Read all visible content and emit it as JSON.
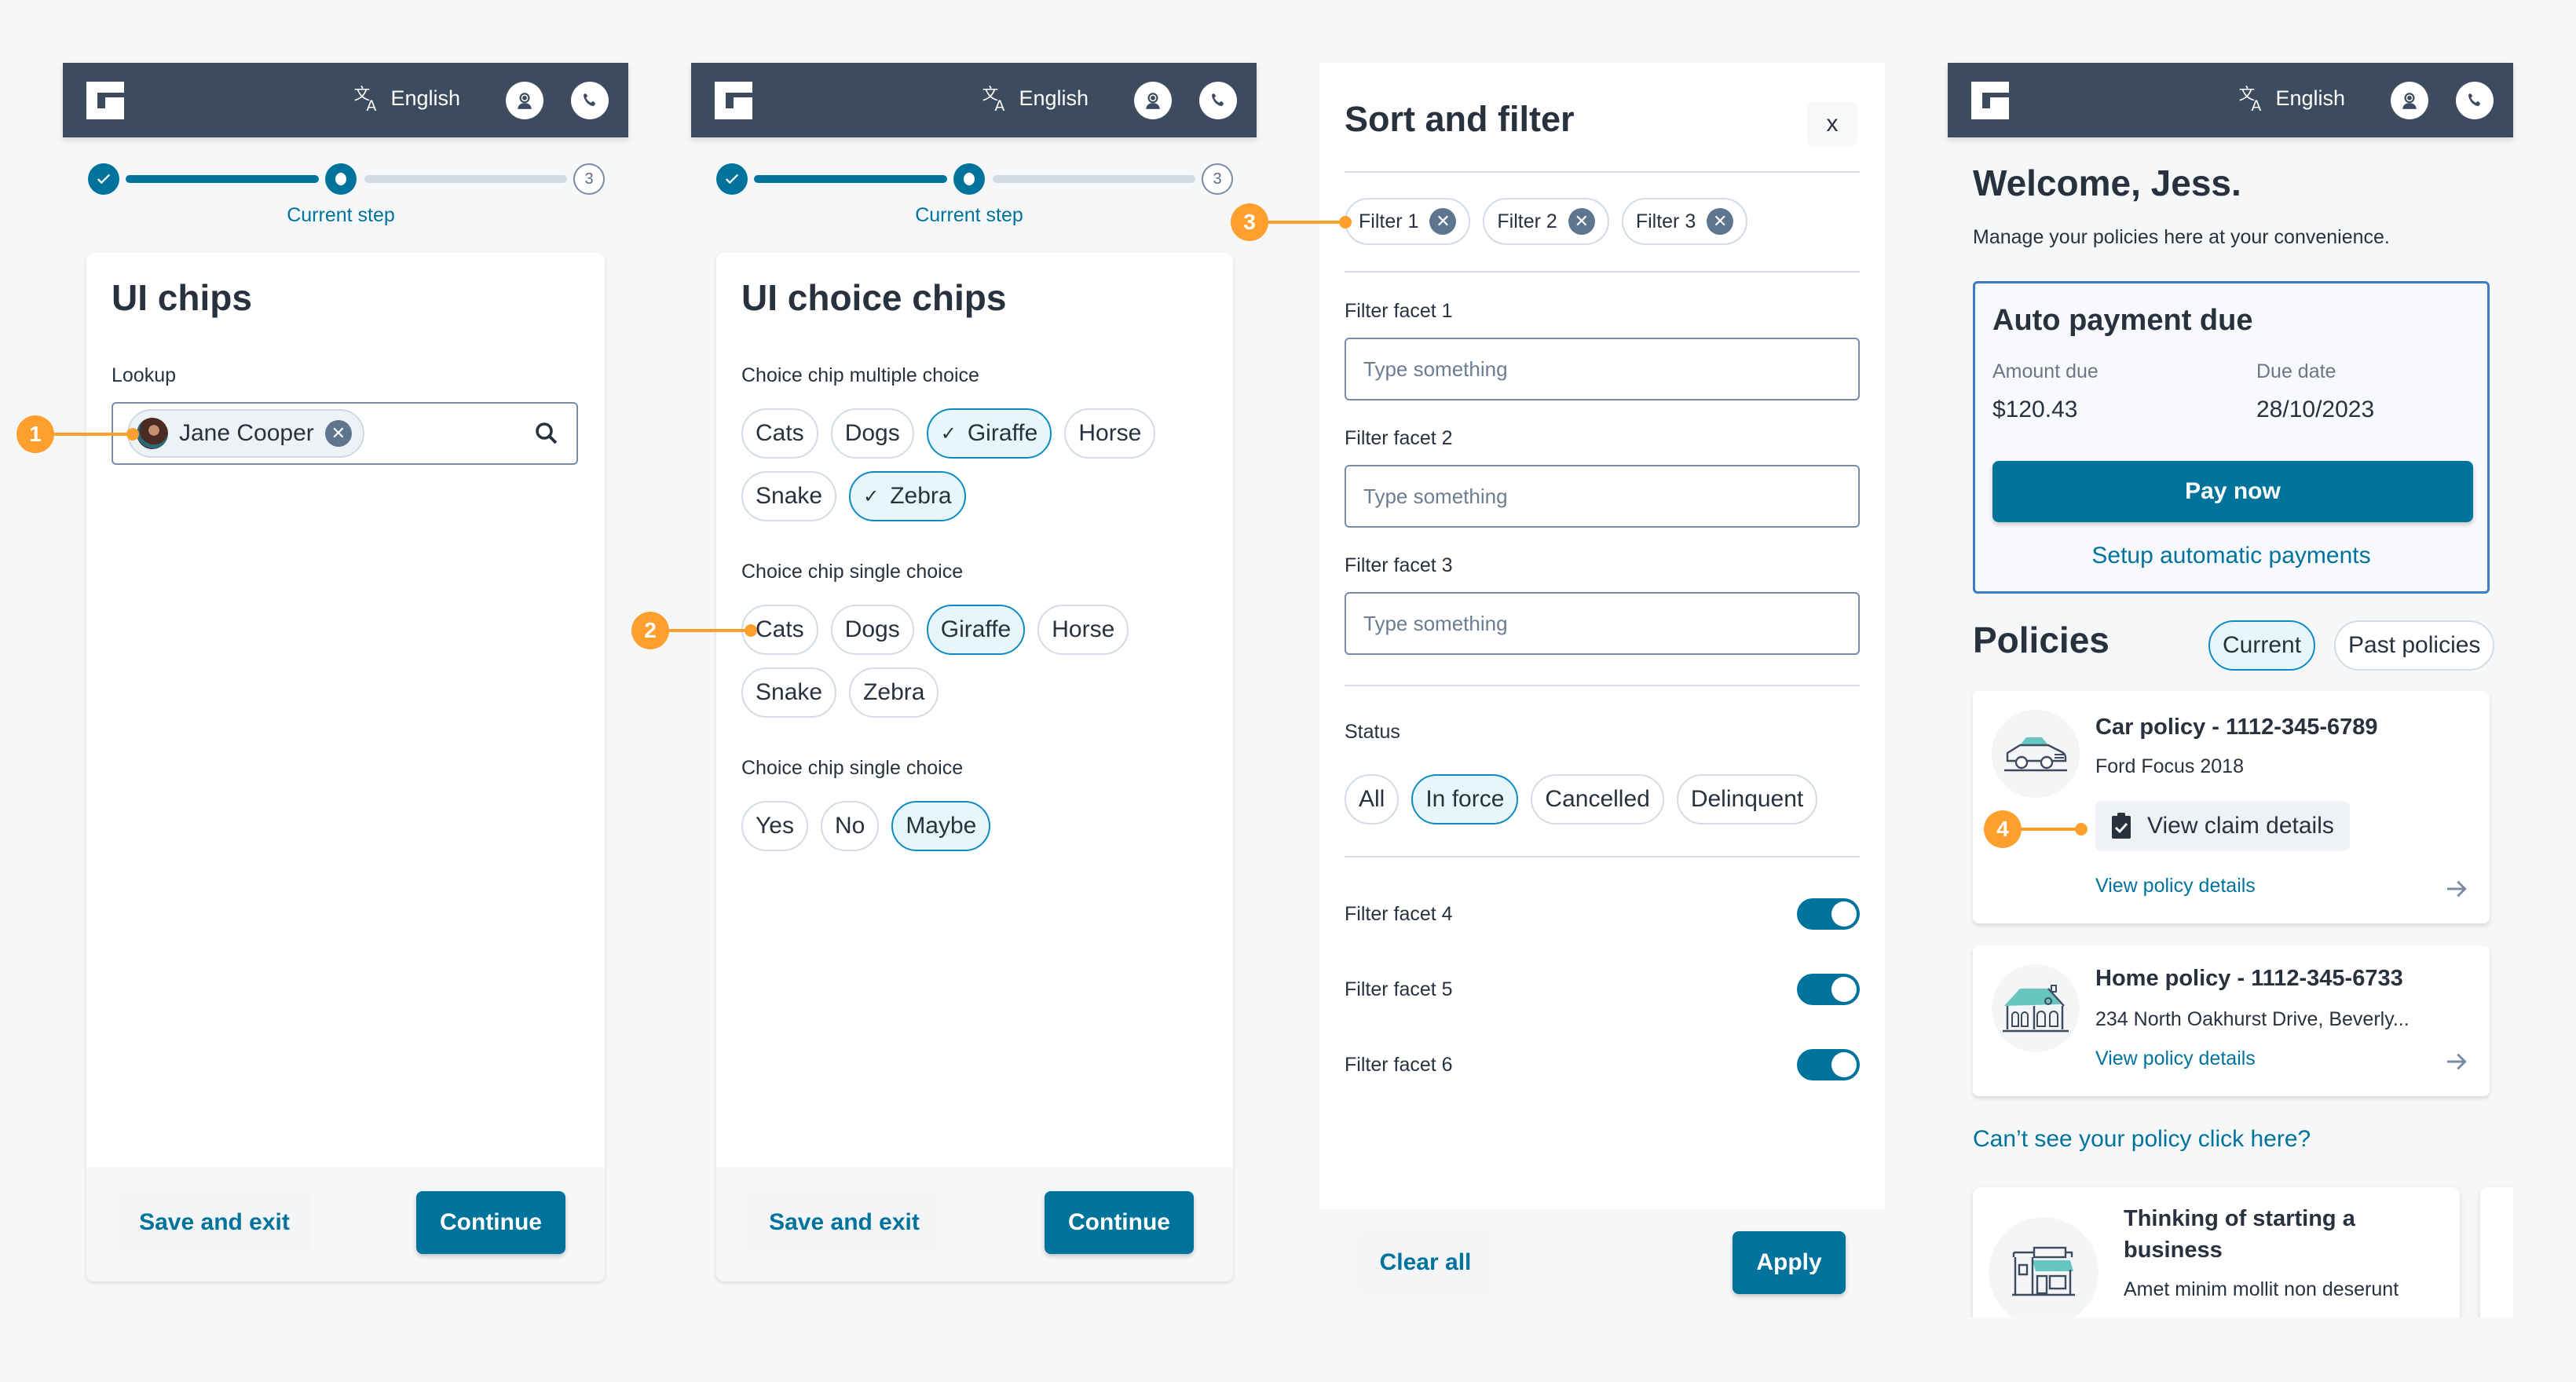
{
  "header": {
    "language": "English",
    "icons": {
      "logo": "brand-logo",
      "language": "translate-icon",
      "agent": "agent-icon",
      "phone": "phone-icon"
    }
  },
  "stepper": {
    "current_label": "Current step",
    "future_step_number": "3"
  },
  "panel_chips": {
    "title": "UI chips",
    "lookup_label": "Lookup",
    "lookup_chip": "Jane Cooper",
    "save_exit": "Save and exit",
    "continue": "Continue"
  },
  "panel_choice": {
    "title": "UI choice chips",
    "groups": [
      {
        "label": "Choice chip multiple choice",
        "chips": [
          {
            "label": "Cats",
            "selected": false
          },
          {
            "label": "Dogs",
            "selected": false
          },
          {
            "label": "Giraffe",
            "selected": true,
            "check": true
          },
          {
            "label": "Horse",
            "selected": false
          },
          {
            "label": "Snake",
            "selected": false
          },
          {
            "label": "Zebra",
            "selected": true,
            "check": true
          }
        ]
      },
      {
        "label": "Choice chip single choice",
        "chips": [
          {
            "label": "Cats",
            "selected": false
          },
          {
            "label": "Dogs",
            "selected": false
          },
          {
            "label": "Giraffe",
            "selected": true
          },
          {
            "label": "Horse",
            "selected": false
          },
          {
            "label": "Snake",
            "selected": false
          },
          {
            "label": "Zebra",
            "selected": false
          }
        ]
      },
      {
        "label": "Choice chip single choice",
        "chips": [
          {
            "label": "Yes",
            "selected": false
          },
          {
            "label": "No",
            "selected": false
          },
          {
            "label": "Maybe",
            "selected": true
          }
        ]
      }
    ],
    "save_exit": "Save and exit",
    "continue": "Continue"
  },
  "panel_filter": {
    "title": "Sort and filter",
    "close": "x",
    "active_filters": [
      "Filter 1",
      "Filter 2",
      "Filter 3"
    ],
    "facets": [
      {
        "label": "Filter facet 1",
        "placeholder": "Type something",
        "value": ""
      },
      {
        "label": "Filter facet 2",
        "placeholder": "Type something",
        "value": ""
      },
      {
        "label": "Filter facet 3",
        "placeholder": "Type something",
        "value": ""
      }
    ],
    "status_label": "Status",
    "status_chips": [
      {
        "label": "All",
        "selected": false
      },
      {
        "label": "In force",
        "selected": true
      },
      {
        "label": "Cancelled",
        "selected": false
      },
      {
        "label": "Delinquent",
        "selected": false
      }
    ],
    "toggles": [
      {
        "label": "Filter facet 4",
        "on": true
      },
      {
        "label": "Filter facet 5",
        "on": true
      },
      {
        "label": "Filter facet 6",
        "on": true
      }
    ],
    "clear_all": "Clear all",
    "apply": "Apply"
  },
  "panel_dashboard": {
    "welcome": "Welcome, Jess.",
    "subtitle": "Manage your policies here at your convenience.",
    "payment": {
      "title": "Auto payment due",
      "amount_label": "Amount due",
      "amount": "$120.43",
      "due_label": "Due date",
      "due": "28/10/2023",
      "pay_now": "Pay now",
      "setup": "Setup automatic payments"
    },
    "policies_title": "Policies",
    "tabs": [
      {
        "label": "Current",
        "selected": true
      },
      {
        "label": "Past policies",
        "selected": false
      }
    ],
    "policies": [
      {
        "title": "Car policy - 1112-345-6789",
        "subtitle": "Ford Focus 2018",
        "claim": "View claim details",
        "link": "View policy details",
        "icon": "car-icon"
      },
      {
        "title": "Home policy - 1112-345-6733",
        "subtitle": "234 North Oakhurst Drive, Beverly...",
        "link": "View policy details",
        "icon": "house-icon"
      }
    ],
    "cant_see": "Can’t  see your policy click here?",
    "promo": {
      "title": "Thinking of starting a business",
      "body": "Amet minim mollit non deserunt",
      "icon": "storefront-icon"
    }
  },
  "annotations": [
    "1",
    "2",
    "3",
    "4"
  ],
  "colors": {
    "brand": "#00739d",
    "header": "#3d4b5e",
    "annotation": "#ff9f2e",
    "chip_selected_bg": "#e8f6fc",
    "chip_selected_border": "#0e8cc1",
    "accent_teal": "#67c6c1"
  }
}
